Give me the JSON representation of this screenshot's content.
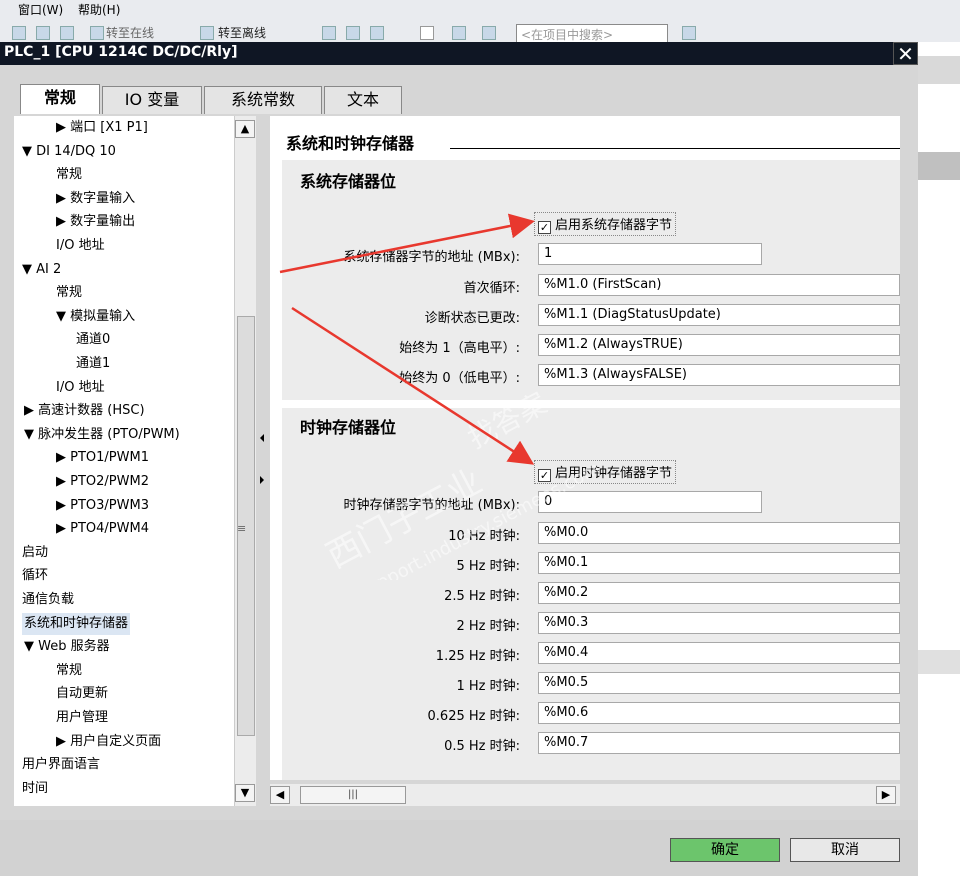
{
  "menu": {
    "window": "窗口(W)",
    "help": "帮助(H)"
  },
  "toolbar": {
    "go_online": "转至在线",
    "go_offline": "转至离线",
    "search_placeholder": "<在项目中搜索>"
  },
  "dialog": {
    "title": "PLC_1 [CPU 1214C DC/DC/Rly]"
  },
  "tabs": [
    "常规",
    "IO 变量",
    "系统常数",
    "文本"
  ],
  "tree": [
    {
      "label": "▶ 端口 [X1 P1]",
      "indent": 3
    },
    {
      "label": "▼ DI 14/DQ 10",
      "indent": 1
    },
    {
      "label": "常规",
      "indent": 3
    },
    {
      "label": "▶ 数字量输入",
      "indent": 2
    },
    {
      "label": "▶ 数字量输出",
      "indent": 2
    },
    {
      "label": "I/O 地址",
      "indent": 3
    },
    {
      "label": "▼ AI 2",
      "indent": 1
    },
    {
      "label": "常规",
      "indent": 3
    },
    {
      "label": "▼ 模拟量输入",
      "indent": 2
    },
    {
      "label": "通道0",
      "indent": 4
    },
    {
      "label": "通道1",
      "indent": 4
    },
    {
      "label": "I/O 地址",
      "indent": 3
    },
    {
      "label": "▶ 高速计数器 (HSC)",
      "indent": 0
    },
    {
      "label": "▼ 脉冲发生器 (PTO/PWM)",
      "indent": 0
    },
    {
      "label": "▶ PTO1/PWM1",
      "indent": 2
    },
    {
      "label": "▶ PTO2/PWM2",
      "indent": 2
    },
    {
      "label": "▶ PTO3/PWM3",
      "indent": 2
    },
    {
      "label": "▶ PTO4/PWM4",
      "indent": 2
    },
    {
      "label": "启动",
      "indent": 1
    },
    {
      "label": "循环",
      "indent": 1
    },
    {
      "label": "通信负载",
      "indent": 1
    },
    {
      "label": "系统和时钟存储器",
      "indent": 1
    },
    {
      "label": "▼ Web 服务器",
      "indent": 0
    },
    {
      "label": "常规",
      "indent": 3
    },
    {
      "label": "自动更新",
      "indent": 3
    },
    {
      "label": "用户管理",
      "indent": 3
    },
    {
      "label": "▶ 用户自定义页面",
      "indent": 2
    },
    {
      "label": "用户界面语言",
      "indent": 1
    },
    {
      "label": "时间",
      "indent": 1
    }
  ],
  "content": {
    "section_title": "系统和时钟存储器",
    "system_group": {
      "title": "系统存储器位",
      "enable_label": "启用系统存储器字节",
      "address_label": "系统存储器字节的地址 (MBx):",
      "address_value": "1",
      "rows": [
        {
          "label": "首次循环:",
          "value": "%M1.0 (FirstScan)"
        },
        {
          "label": "诊断状态已更改:",
          "value": "%M1.1 (DiagStatusUpdate)"
        },
        {
          "label": "始终为 1（高电平）:",
          "value": "%M1.2 (AlwaysTRUE)"
        },
        {
          "label": "始终为 0（低电平）:",
          "value": "%M1.3 (AlwaysFALSE)"
        }
      ]
    },
    "clock_group": {
      "title": "时钟存储器位",
      "enable_label": "启用时钟存储器字节",
      "address_label": "时钟存储器字节的地址 (MBx):",
      "address_value": "0",
      "rows": [
        {
          "label": "10 Hz 时钟:",
          "value": "%M0.0"
        },
        {
          "label": "5 Hz 时钟:",
          "value": "%M0.1"
        },
        {
          "label": "2.5 Hz 时钟:",
          "value": "%M0.2"
        },
        {
          "label": "2 Hz 时钟:",
          "value": "%M0.3"
        },
        {
          "label": "1.25 Hz 时钟:",
          "value": "%M0.4"
        },
        {
          "label": "1 Hz 时钟:",
          "value": "%M0.5"
        },
        {
          "label": "0.625 Hz 时钟:",
          "value": "%M0.6"
        },
        {
          "label": "0.5 Hz 时钟:",
          "value": "%M0.7"
        }
      ]
    }
  },
  "buttons": {
    "ok": "确定",
    "cancel": "取消"
  },
  "watermark": {
    "line1": "西门子工业",
    "line2": "support.industry.siemens.com",
    "line3": "找答案"
  },
  "colors": {
    "ok_button": "#6cc56c",
    "arrow": "#e8382e",
    "selection": "#dbe6f3"
  }
}
